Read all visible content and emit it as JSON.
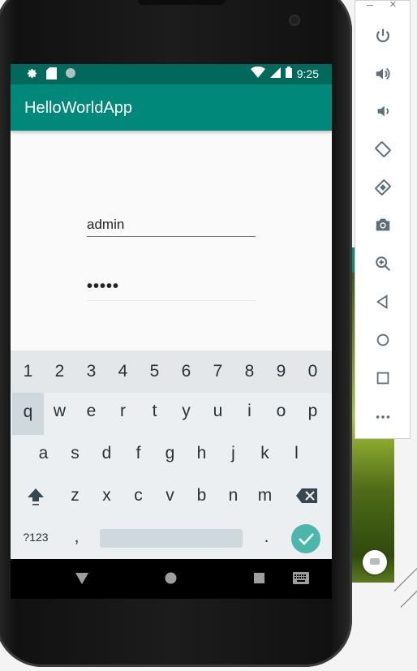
{
  "app": {
    "title": "HelloWorldApp"
  },
  "status_bar": {
    "time": "9:25",
    "icons_left": [
      "gear-icon",
      "sd-card-icon",
      "circle-icon"
    ],
    "icons_right": [
      "wifi-icon",
      "signal-icon",
      "battery-icon"
    ]
  },
  "form": {
    "username_value": "admin",
    "password_value": "•••••"
  },
  "keyboard": {
    "numbers": [
      "1",
      "2",
      "3",
      "4",
      "5",
      "6",
      "7",
      "8",
      "9",
      "0"
    ],
    "row1": [
      "q",
      "w",
      "e",
      "r",
      "t",
      "y",
      "u",
      "i",
      "o",
      "p"
    ],
    "row2": [
      "a",
      "s",
      "d",
      "f",
      "g",
      "h",
      "j",
      "k",
      "l"
    ],
    "row3": [
      "z",
      "x",
      "c",
      "v",
      "b",
      "n",
      "m"
    ],
    "symbols_label": "?123",
    "comma": ",",
    "period": "."
  },
  "nav_bar": {
    "buttons": [
      "back-icon",
      "home-icon",
      "recents-icon",
      "keyboard-icon"
    ]
  },
  "emulator_toolbar": {
    "window_buttons": {
      "minimize": "–",
      "close": "×"
    },
    "buttons": [
      "power",
      "volume-up",
      "volume-down",
      "rotate-left",
      "rotate-right",
      "screenshot",
      "zoom",
      "back",
      "home",
      "overview",
      "more"
    ]
  },
  "colors": {
    "status_bar": "#00695c",
    "app_bar": "#00897b",
    "accent": "#4db6ac",
    "keyboard_bg": "#eceff1"
  }
}
